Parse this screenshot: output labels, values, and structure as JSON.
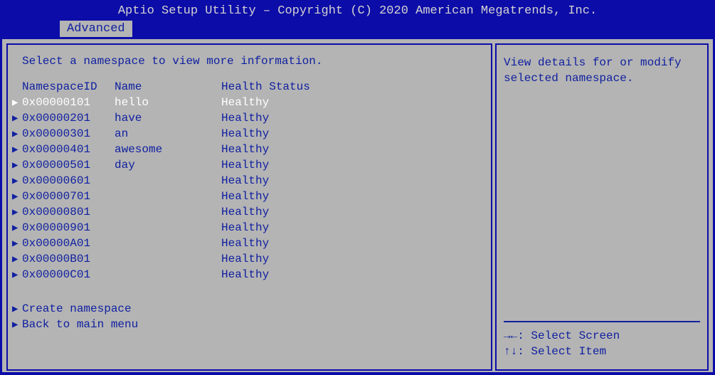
{
  "header": {
    "title": "Aptio Setup Utility – Copyright (C) 2020 American Megatrends, Inc."
  },
  "tab": {
    "label": "Advanced"
  },
  "main": {
    "prompt": "Select a namespace to view more information.",
    "columns": {
      "id": "NamespaceID",
      "name": "Name",
      "health": "Health Status"
    },
    "rows": [
      {
        "id": "0x00000101",
        "name": "hello",
        "health": "Healthy",
        "selected": true
      },
      {
        "id": "0x00000201",
        "name": "have",
        "health": "Healthy",
        "selected": false
      },
      {
        "id": "0x00000301",
        "name": "an",
        "health": "Healthy",
        "selected": false
      },
      {
        "id": "0x00000401",
        "name": "awesome",
        "health": "Healthy",
        "selected": false
      },
      {
        "id": "0x00000501",
        "name": "day",
        "health": "Healthy",
        "selected": false
      },
      {
        "id": "0x00000601",
        "name": "",
        "health": "Healthy",
        "selected": false
      },
      {
        "id": "0x00000701",
        "name": "",
        "health": "Healthy",
        "selected": false
      },
      {
        "id": "0x00000801",
        "name": "",
        "health": "Healthy",
        "selected": false
      },
      {
        "id": "0x00000901",
        "name": "",
        "health": "Healthy",
        "selected": false
      },
      {
        "id": "0x00000A01",
        "name": "",
        "health": "Healthy",
        "selected": false
      },
      {
        "id": "0x00000B01",
        "name": "",
        "health": "Healthy",
        "selected": false
      },
      {
        "id": "0x00000C01",
        "name": "",
        "health": "Healthy",
        "selected": false
      }
    ],
    "actions": {
      "create": "Create namespace",
      "back": "Back to main menu"
    }
  },
  "side": {
    "help_line1": "View details for or modify",
    "help_line2": "selected namespace.",
    "keys": {
      "screen": "Select Screen",
      "item": "Select Item",
      "screen_sym": "→←:",
      "item_sym": "↑↓:"
    }
  },
  "glyphs": {
    "arrow": "▶"
  }
}
